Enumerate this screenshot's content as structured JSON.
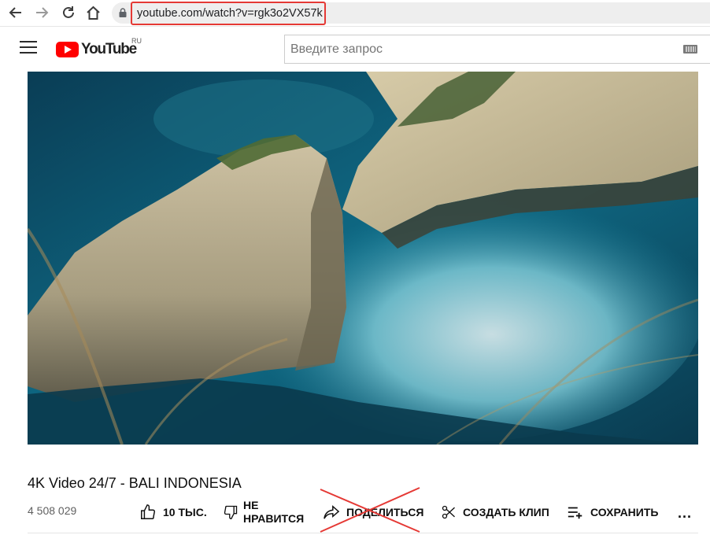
{
  "browser": {
    "url": "youtube.com/watch?v=rgk3o2VX57k",
    "highlight_color": "#e53935"
  },
  "header": {
    "logo_text": "YouTube",
    "region": "RU",
    "search_placeholder": "Введите запрос",
    "brand_color": "#ff0000"
  },
  "video": {
    "title": "4K Video 24/7 - BALI INDONESIA",
    "views": "4 508 029"
  },
  "actions": {
    "like_count": "10 ТЫС.",
    "dislike_line1": "НЕ",
    "dislike_line2": "НРАВИТСЯ",
    "share_label": "ПОДЕЛИТЬСЯ",
    "clip_label": "СОЗДАТЬ КЛИП",
    "save_label": "СОХРАНИТЬ",
    "more_label": "..."
  },
  "icons": [
    "back-arrow-icon",
    "forward-arrow-icon",
    "reload-icon",
    "home-icon",
    "lock-icon",
    "menu-icon",
    "keyboard-icon",
    "thumb-up-icon",
    "thumb-down-icon",
    "share-icon",
    "scissors-icon",
    "playlist-add-icon",
    "more-icon"
  ]
}
